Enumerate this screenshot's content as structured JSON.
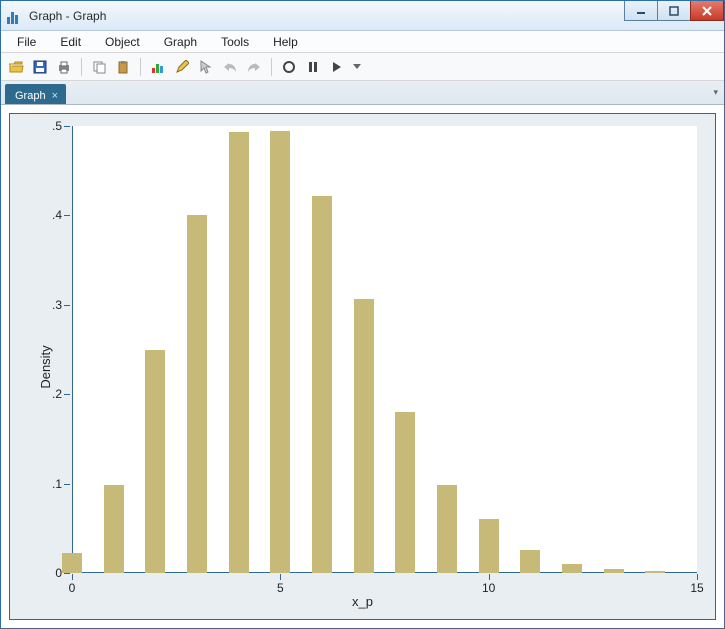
{
  "window": {
    "title": "Graph - Graph",
    "controls": {
      "minimize": "minimize",
      "maximize": "maximize",
      "close": "close"
    }
  },
  "menu": {
    "items": [
      "File",
      "Edit",
      "Object",
      "Graph",
      "Tools",
      "Help"
    ]
  },
  "toolbar": {
    "icons": [
      "open",
      "save",
      "print",
      "copy",
      "paste",
      "chart",
      "edit",
      "pointer",
      "undo",
      "redo",
      "record",
      "pause",
      "play",
      "more"
    ]
  },
  "tabs": {
    "active": {
      "label": "Graph",
      "close": "×"
    }
  },
  "chart_data": {
    "type": "bar",
    "xlabel": "x_p",
    "ylabel": "Density",
    "xlim": [
      0,
      15
    ],
    "ylim": [
      0,
      0.5
    ],
    "xticks": [
      0,
      5,
      10,
      15
    ],
    "yticks": [
      0,
      0.1,
      0.2,
      0.3,
      0.4,
      0.5
    ],
    "ytick_labels": [
      "0",
      ".1",
      ".2",
      ".3",
      ".4",
      ".5"
    ],
    "bar_centers": [
      0,
      1,
      2,
      3,
      4,
      5,
      6,
      7,
      8,
      9,
      10,
      11,
      12,
      13,
      14
    ],
    "values": [
      0.022,
      0.098,
      0.25,
      0.4,
      0.493,
      0.494,
      0.422,
      0.306,
      0.18,
      0.098,
      0.06,
      0.026,
      0.01,
      0.005,
      0.002
    ]
  }
}
